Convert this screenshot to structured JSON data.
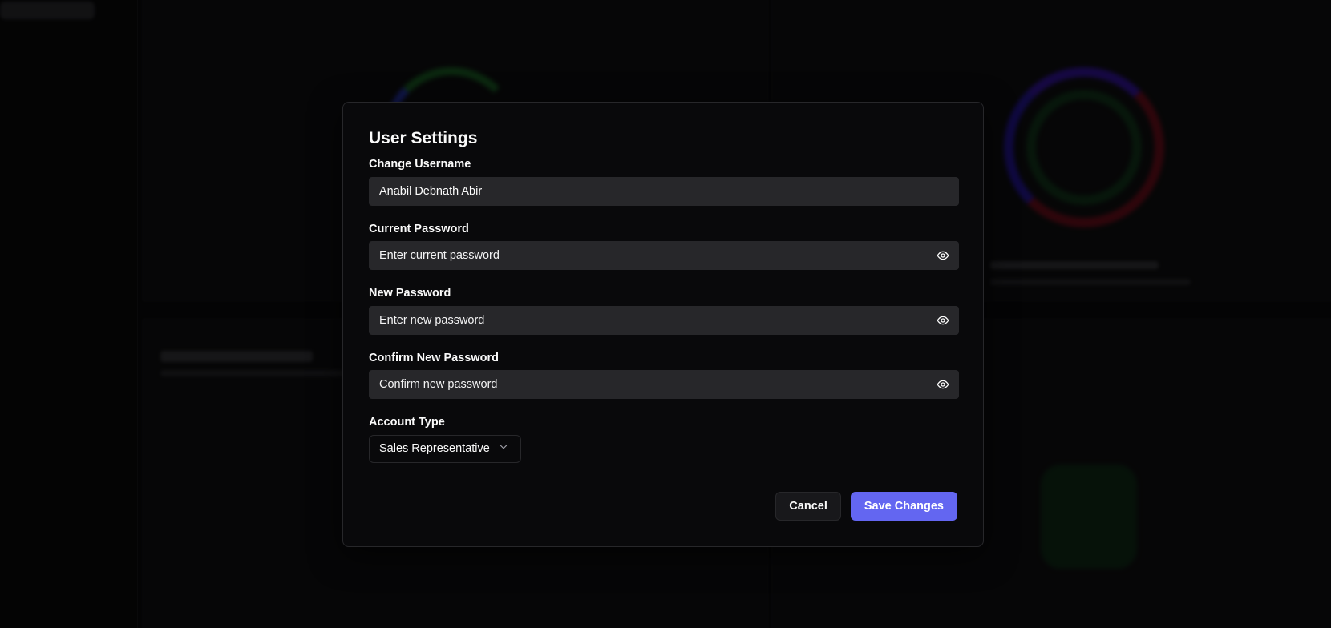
{
  "dialog": {
    "title": "User Settings",
    "username": {
      "label": "Change Username",
      "value": "Anabil Debnath Abir"
    },
    "current_password": {
      "label": "Current Password",
      "placeholder": "Enter current password",
      "toggle_icon": "eye-icon"
    },
    "new_password": {
      "label": "New Password",
      "placeholder": "Enter new password",
      "toggle_icon": "eye-icon"
    },
    "confirm_password": {
      "label": "Confirm New Password",
      "placeholder": "Confirm new password",
      "toggle_icon": "eye-icon"
    },
    "account_type": {
      "label": "Account Type",
      "selected": "Sales Representative",
      "icon": "chevron-down-icon"
    },
    "buttons": {
      "cancel": "Cancel",
      "save": "Save Changes"
    }
  },
  "colors": {
    "accent": "#6366f1",
    "dialog_bg": "#09090b",
    "input_bg": "#27272a"
  }
}
